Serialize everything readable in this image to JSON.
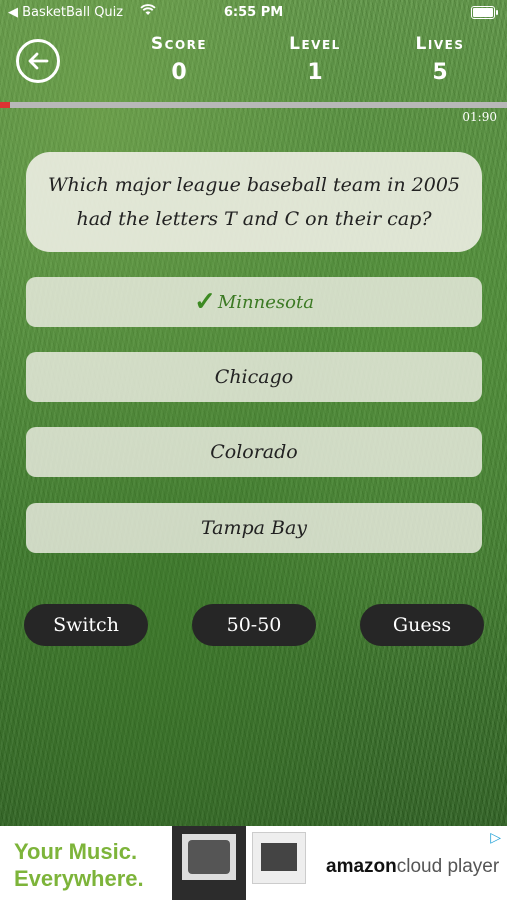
{
  "status_bar": {
    "back_app": "◀ BasketBall Quiz",
    "time": "6:55 PM"
  },
  "header": {
    "score": {
      "label": "Score",
      "value": "0"
    },
    "level": {
      "label": "Level",
      "value": "1"
    },
    "lives": {
      "label": "Lives",
      "value": "5"
    }
  },
  "timer": {
    "text": "01:90",
    "progress_fraction": 0.02
  },
  "question": {
    "text": "Which major league baseball team in 2005 had the letters T and C on their cap?"
  },
  "answers": [
    {
      "label": "Minnesota",
      "state": "correct"
    },
    {
      "label": "Chicago"
    },
    {
      "label": "Colorado"
    },
    {
      "label": "Tampa Bay"
    }
  ],
  "lifelines": {
    "switch": "Switch",
    "fifty": "50-50",
    "guess": "Guess"
  },
  "ad": {
    "tagline_1": "Your Music.",
    "tagline_2": "Everywhere.",
    "brand_1": "amazon",
    "brand_2": "cloud player"
  },
  "colors": {
    "progress": "#dd3333",
    "correct": "#3c8a22",
    "pill": "#262626",
    "ad_green": "#7db43a"
  }
}
